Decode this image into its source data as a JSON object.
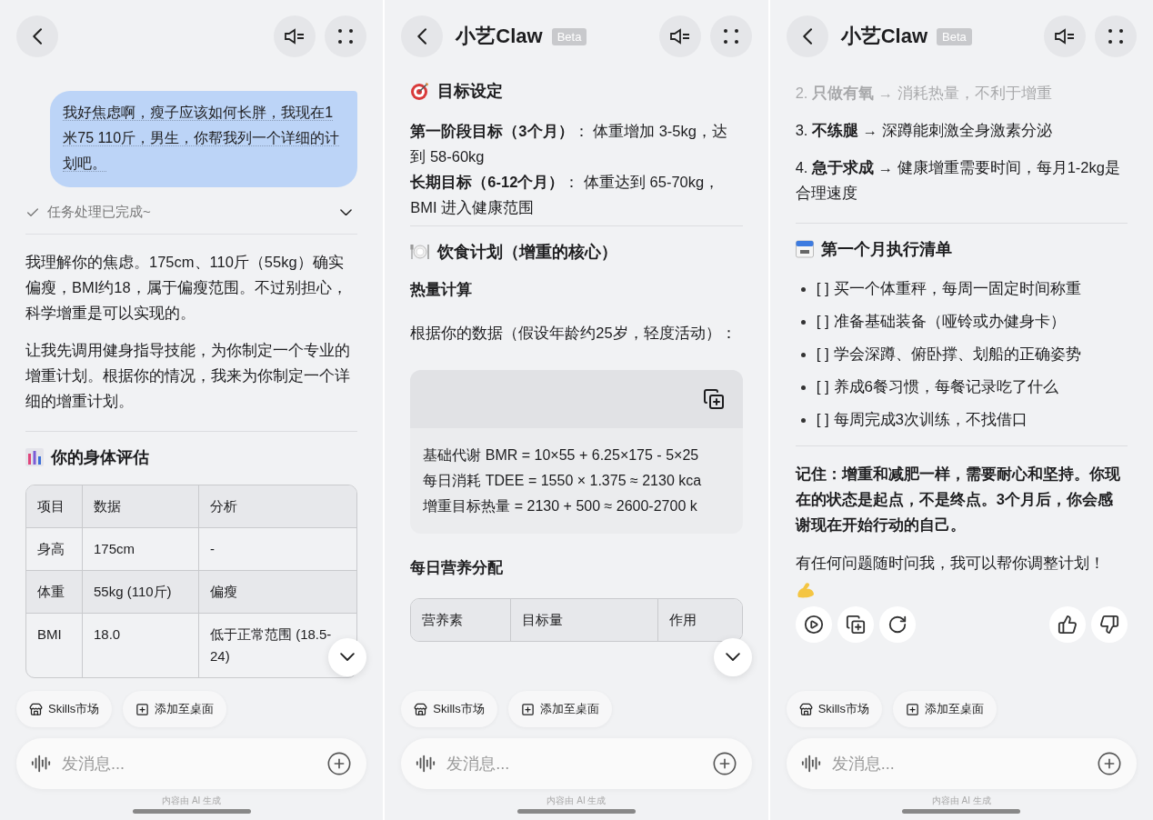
{
  "screens": [
    {
      "scroll_down": true,
      "blocks": [
        {
          "kind": "user_message",
          "text": "我好焦虑啊，瘦子应该如何长胖，我现在1米75 110斤，男生，你帮我列一个详细的计划吧。"
        },
        {
          "kind": "status",
          "text": "任务处理已完成~",
          "expanded": false
        },
        {
          "kind": "paragraph",
          "text": "我理解你的焦虑。175cm、110斤（55kg）确实偏瘦，BMI约18，属于偏瘦范围。不过别担心，科学增重是可以实现的。"
        },
        {
          "kind": "paragraph",
          "text": "让我先调用健身指导技能，为你制定一个专业的增重计划。根据你的情况，我来为你制定一个详细的增重计划。"
        },
        {
          "kind": "divider"
        },
        {
          "kind": "heading",
          "text": "你的身体评估"
        },
        {
          "kind": "table",
          "columns": [
            "项目",
            "数据",
            "分析"
          ],
          "rows": [
            [
              "身高",
              "175cm",
              "-"
            ],
            [
              "体重",
              "55kg (110斤)",
              "偏瘦"
            ],
            [
              "BMI",
              "18.0",
              "低于正常范围 (18.5-24)"
            ]
          ]
        }
      ],
      "chips": [
        {
          "kind": "market",
          "label": "Skills市场"
        },
        {
          "kind": "add",
          "label": "添加至桌面"
        }
      ],
      "placeholder": "发消息...",
      "footnote": "内容由 AI 生成"
    },
    {
      "title": "小艺Claw",
      "badge": "Beta",
      "scroll_down": true,
      "blocks": [
        {
          "kind": "heading",
          "text": "目标设定"
        },
        {
          "kind": "goal",
          "text": "**第一阶段目标（3个月）**： 体重增加 3-5kg，达到 58-60kg"
        },
        {
          "kind": "goal",
          "text": "**长期目标（6-12个月）**： 体重达到 65-70kg，BMI 进入健康范围"
        },
        {
          "kind": "divider"
        },
        {
          "kind": "heading",
          "text": "饮食计划（增重的核心）"
        },
        {
          "kind": "subheading",
          "text": "热量计算"
        },
        {
          "kind": "paragraph",
          "text": "根据你的数据（假设年龄约25岁，轻度活动）："
        },
        {
          "kind": "code",
          "lines": [
            "基础代谢 BMR = 10×55 + 6.25×175 - 5×25",
            "每日消耗 TDEE = 1550 × 1.375 ≈ 2130 kca",
            "增重目标热量 = 2130 + 500 ≈ 2600-2700 k"
          ]
        },
        {
          "kind": "subheading",
          "text": "每日营养分配"
        },
        {
          "kind": "table",
          "columns": [
            "营养素",
            "目标量",
            "作用"
          ]
        }
      ],
      "chips": [
        {
          "kind": "market",
          "label": "Skills市场"
        },
        {
          "kind": "add",
          "label": "添加至桌面"
        }
      ],
      "placeholder": "发消息...",
      "footnote": "内容由 AI 生成"
    },
    {
      "title": "小艺Claw",
      "badge": "Beta",
      "scroll_down": false,
      "blocks": [
        {
          "kind": "numbered",
          "text": "2. **只做有氧** → 消耗热量，不利于增重",
          "faded": true
        },
        {
          "kind": "numbered",
          "text": "3. **不练腿** → 深蹲能刺激全身激素分泌",
          "faded": false
        },
        {
          "kind": "numbered",
          "text": "4. **急于求成** → 健康增重需要时间，每月1-2kg是合理速度",
          "faded": false
        },
        {
          "kind": "divider"
        },
        {
          "kind": "heading",
          "text": "第一个月执行清单"
        },
        {
          "kind": "checklist",
          "items": [
            "[ ] 买一个体重秤，每周一固定时间称重",
            "[ ] 准备基础装备（哑铃或办健身卡）",
            "[ ] 学会深蹲、俯卧撑、划船的正确姿势",
            "[ ] 养成6餐习惯，每餐记录吃了什么",
            "[ ] 每周完成3次训练，不找借口"
          ]
        },
        {
          "kind": "divider"
        },
        {
          "kind": "emphasis",
          "text": "记住：增重和减肥一样，需要耐心和坚持。你现在的状态是起点，不是终点。3个月后，你会感谢现在开始行动的自己。"
        },
        {
          "kind": "closing",
          "text": "有任何问题随时问我，我可以帮你调整计划！"
        },
        {
          "kind": "actions"
        }
      ],
      "chips": [
        {
          "kind": "market",
          "label": "Skills市场"
        },
        {
          "kind": "add",
          "label": "添加至桌面"
        }
      ],
      "placeholder": "发消息...",
      "footnote": "内容由 AI 生成"
    }
  ]
}
